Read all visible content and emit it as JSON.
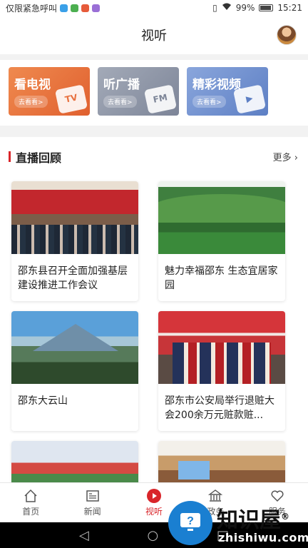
{
  "status_bar": {
    "left_text": "仅限紧急呼叫",
    "battery": "99%",
    "time": "15:21"
  },
  "header": {
    "title": "视听"
  },
  "categories": [
    {
      "title": "看电视",
      "action": "去看看>",
      "deco": "TV",
      "color": "#e8713f"
    },
    {
      "title": "听广播",
      "action": "去看看>",
      "deco": "FM",
      "color": "#8e96a8"
    },
    {
      "title": "精彩视频",
      "action": "去看看>",
      "deco": "▶",
      "color": "#6f8fcf"
    }
  ],
  "section": {
    "title": "直播回顾",
    "more": "更多 ›"
  },
  "news": [
    {
      "title": "邵东县召开全面加强基层建设推进工作会议"
    },
    {
      "title": "魅力幸福邵东 生态宜居家园"
    },
    {
      "title": "邵东大云山"
    },
    {
      "title": "邵东市公安局举行退赃大会200余万元赃款赃..."
    },
    {
      "title": ""
    },
    {
      "title": ""
    }
  ],
  "bottom_nav": [
    {
      "label": "首页",
      "icon": "home-icon"
    },
    {
      "label": "新闻",
      "icon": "news-icon"
    },
    {
      "label": "视听",
      "icon": "play-icon"
    },
    {
      "label": "政务",
      "icon": "government-icon"
    },
    {
      "label": "服务",
      "icon": "heart-icon"
    }
  ],
  "system_bar": {
    "back": "◁",
    "home": "○",
    "recent": "□"
  },
  "watermark": {
    "name": "知识屋",
    "registered": "®",
    "url": "zhishiwu.com"
  }
}
